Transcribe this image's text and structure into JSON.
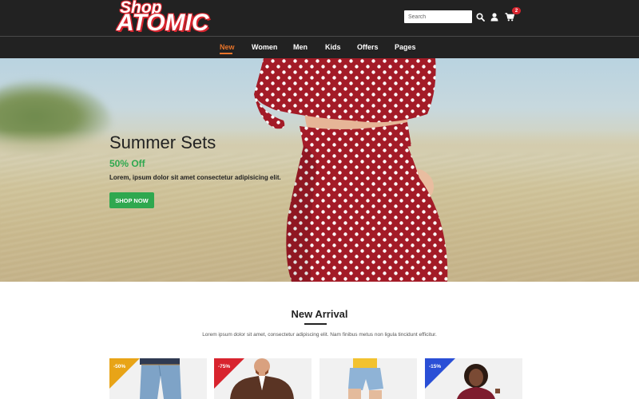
{
  "brand": {
    "top": "Shop",
    "bottom": "ATOMIC"
  },
  "header": {
    "search_placeholder": "Search",
    "cart_count": "2"
  },
  "nav": {
    "items": [
      {
        "label": "New",
        "active": true
      },
      {
        "label": "Women"
      },
      {
        "label": "Men"
      },
      {
        "label": "Kids"
      },
      {
        "label": "Offers"
      },
      {
        "label": "Pages"
      }
    ]
  },
  "hero": {
    "title": "Summer Sets",
    "subtitle": "50% Off",
    "text": "Lorem, ipsum dolor sit amet consectetur adipisicing elit.",
    "button": "SHOP NOW"
  },
  "new_arrival": {
    "title": "New Arrival",
    "description": "Lorem ipsum dolor sit amet, consectetur adipiscing elit. Nam finibus metus non ligula tincidunt efficitur.",
    "products": [
      {
        "discount": "-50%",
        "color": "#e8a417"
      },
      {
        "discount": "-75%",
        "color": "#d8242e"
      },
      {
        "discount": "",
        "color": ""
      },
      {
        "discount": "-15%",
        "color": "#2a4fd6"
      }
    ]
  },
  "colors": {
    "dark": "#222222",
    "accent_orange": "#e8742a",
    "green": "#2fa84f",
    "red": "#d8242e"
  },
  "icons": [
    "search-icon",
    "user-icon",
    "cart-icon"
  ]
}
